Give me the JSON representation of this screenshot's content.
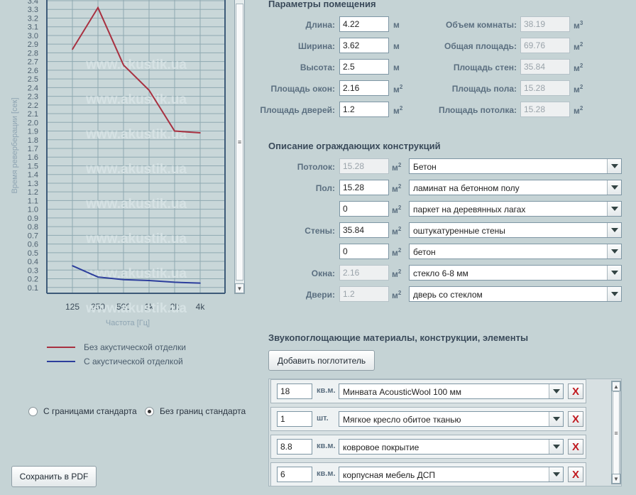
{
  "chart_data": {
    "type": "line",
    "ylabel": "Время реверберации [сек]",
    "xlabel": "Частота [Гц]",
    "watermark": "www.akustik.ua",
    "categories": [
      "125",
      "250",
      "500",
      "1k",
      "2k",
      "4k"
    ],
    "ylim": [
      0,
      3.4
    ],
    "y_ticks": [
      "0.1",
      "0.2",
      "0.3",
      "0.4",
      "0.5",
      "0.6",
      "0.7",
      "0.8",
      "0.9",
      "1.0",
      "1.1",
      "1.2",
      "1.3",
      "1.4",
      "1.5",
      "1.6",
      "1.7",
      "1.8",
      "1.9",
      "2.0",
      "2.1",
      "2.2",
      "2.3",
      "2.4",
      "2.5",
      "2.6",
      "2.7",
      "2.8",
      "2.9",
      "3.0",
      "3.1",
      "3.2",
      "3.3",
      "3.4"
    ],
    "grid": true,
    "series": [
      {
        "name": "Без акустической отделки",
        "color": "#a83040",
        "values": [
          2.84,
          3.32,
          2.66,
          2.37,
          1.9,
          1.88
        ]
      },
      {
        "name": "С акустической отделкой",
        "color": "#2c3e9c",
        "values": [
          0.35,
          0.22,
          0.19,
          0.18,
          0.16,
          0.15
        ]
      }
    ]
  },
  "radio": {
    "option1": "С границами стандарта",
    "option2": "Без границ стандарта",
    "selected": "option2"
  },
  "save_pdf_label": "Сохранить в PDF",
  "room": {
    "title": "Параметры помещения",
    "length_label": "Длина:",
    "length_value": "4.22",
    "length_unit": "м",
    "width_label": "Ширина:",
    "width_value": "3.62",
    "width_unit": "м",
    "height_label": "Высота:",
    "height_value": "2.5",
    "height_unit": "м",
    "windows_label": "Площадь окон:",
    "windows_value": "2.16",
    "windows_unit": "м",
    "doors_label": "Площадь дверей:",
    "doors_value": "1.2",
    "doors_unit": "м",
    "volume_label": "Объем комнаты:",
    "volume_value": "38.19",
    "volume_unit": "м",
    "total_label": "Общая площадь:",
    "total_value": "69.76",
    "total_unit": "м",
    "walls_label": "Площадь стен:",
    "walls_value": "35.84",
    "walls_unit": "м",
    "floor_label": "Площадь пола:",
    "floor_value": "15.28",
    "floor_unit": "м",
    "ceiling_label": "Площадь потолка:",
    "ceiling_value": "15.28",
    "ceiling_unit": "м"
  },
  "constructions": {
    "title": "Описание ограждающих конструкций",
    "ceiling_label": "Потолок:",
    "ceiling_value": "15.28",
    "ceiling_material": "Бетон",
    "floor_label": "Пол:",
    "floor_value": "15.28",
    "floor_material": "ламинат на бетонном полу",
    "floor2_value": "0",
    "floor2_material": "паркет на деревянных лагах",
    "walls_label": "Стены:",
    "walls_value": "35.84",
    "walls_material": "оштукатуренные стены",
    "walls2_value": "0",
    "walls2_material": "бетон",
    "windows_label": "Окна:",
    "windows_value": "2.16",
    "windows_material": "стекло 6-8 мм",
    "doors_label": "Двери:",
    "doors_value": "1.2",
    "doors_material": "дверь со стеклом",
    "unit": "м"
  },
  "absorbers": {
    "title": "Звукопоглощающие материалы, конструкции, элементы",
    "add_label": "Добавить поглотитель",
    "items": [
      {
        "qty": "18",
        "unit": "кв.м.",
        "material": "Минвата AcousticWool 100 мм"
      },
      {
        "qty": "1",
        "unit": "шт.",
        "material": "Мягкое кресло обитое тканью"
      },
      {
        "qty": "8.8",
        "unit": "кв.м.",
        "material": "ковровое покрытие"
      },
      {
        "qty": "6",
        "unit": "кв.м.",
        "material": "корпусная мебель ДСП"
      }
    ],
    "delete_glyph": "X"
  },
  "colors": {
    "background": "#c5d3d5",
    "accent_red": "#a83040",
    "accent_blue": "#2c3e9c"
  }
}
